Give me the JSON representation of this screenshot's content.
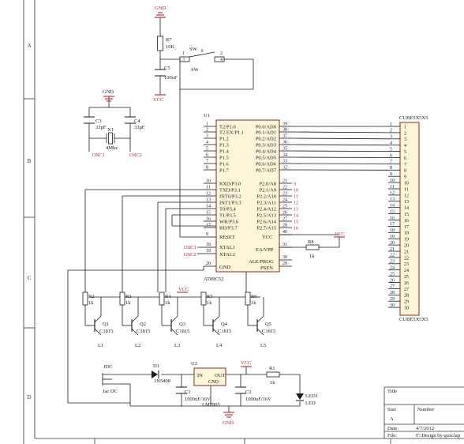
{
  "frame": {
    "rows": [
      "A",
      "B",
      "C",
      "D"
    ],
    "cols": [
      "1",
      "2",
      "3",
      "4"
    ]
  },
  "title_block": {
    "title_label": "Title",
    "size_label": "Size",
    "size_value": "A",
    "number_label": "Number",
    "date_label": "Date:",
    "date_value": "4/7/2012",
    "file_label": "File:",
    "file_value": "F:\\Design by quxclap"
  },
  "u1": {
    "ref": "U1",
    "part": "AT89C52",
    "left_pins": [
      {
        "num": "1",
        "name": "T2/P1.0"
      },
      {
        "num": "2",
        "name": "T2 EX/P1.1"
      },
      {
        "num": "3",
        "name": "P1.2"
      },
      {
        "num": "4",
        "name": "P1.3"
      },
      {
        "num": "5",
        "name": "P1.4"
      },
      {
        "num": "6",
        "name": "P1.5"
      },
      {
        "num": "7",
        "name": "P1.6"
      },
      {
        "num": "8",
        "name": "P1.7"
      },
      {
        "num": "10",
        "name": "RXD/P3.0"
      },
      {
        "num": "11",
        "name": "TXD/P3.1"
      },
      {
        "num": "12",
        "name": "INT0/P3.2"
      },
      {
        "num": "13",
        "name": "INT1/P3.3"
      },
      {
        "num": "14",
        "name": "T0/P3.4"
      },
      {
        "num": "15",
        "name": "T1/P3.5"
      },
      {
        "num": "16",
        "name": "WR/P3.6"
      },
      {
        "num": "17",
        "name": "RD/P3.7"
      }
    ],
    "right_pins": [
      {
        "num": "39",
        "name": "P0.0/AD0"
      },
      {
        "num": "38",
        "name": "P0.1/AD1"
      },
      {
        "num": "37",
        "name": "P0.2/AD2"
      },
      {
        "num": "36",
        "name": "P0.3/AD3"
      },
      {
        "num": "35",
        "name": "P0.4/AD4"
      },
      {
        "num": "34",
        "name": "P0.5/AD5"
      },
      {
        "num": "33",
        "name": "P0.6/AD6"
      },
      {
        "num": "32",
        "name": "P0.7/AD7"
      },
      {
        "num": "21",
        "name": "P2.0/A8",
        "net": "9"
      },
      {
        "num": "22",
        "name": "P2.1/A9",
        "net": "10"
      },
      {
        "num": "23",
        "name": "P2.2/A10",
        "net": "11"
      },
      {
        "num": "24",
        "name": "P2.3/A11",
        "net": "12"
      },
      {
        "num": "25",
        "name": "P2.4/A12",
        "net": "13"
      },
      {
        "num": "26",
        "name": "P2.5/A13",
        "net": "14"
      },
      {
        "num": "27",
        "name": "P2.6/A14",
        "net": "15"
      },
      {
        "num": "28",
        "name": "P2.7/A15",
        "net": "16"
      }
    ],
    "misc_pins": {
      "reset": {
        "num": "9",
        "name": "RESET"
      },
      "vcc": {
        "num": "40",
        "name": "VCC"
      },
      "xtal1": {
        "num": "18",
        "name": "XTAL1"
      },
      "xtal2": {
        "num": "19",
        "name": "XTAL2"
      },
      "gnd": {
        "num": "20",
        "name": "GND"
      },
      "ea": {
        "num": "31",
        "name": "EA/VPP"
      },
      "ale": {
        "num": "30",
        "name": "ALE/PROG"
      },
      "psen": {
        "num": "29",
        "name": "PSEN"
      }
    }
  },
  "cube": {
    "ref": "CUBE5X5X5",
    "part": "CUBE5X5X5",
    "pins": [
      "1",
      "2",
      "3",
      "4",
      "5",
      "6",
      "7",
      "8",
      "9",
      "10",
      "11",
      "12",
      "13",
      "14",
      "15",
      "16",
      "17",
      "18",
      "19",
      "20",
      "21",
      "22",
      "23",
      "24",
      "25",
      "26",
      "27",
      "28",
      "29",
      "30"
    ]
  },
  "reset_circuit": {
    "gnd": "GND",
    "r7_ref": "R7",
    "r7_val": "10K",
    "sw_ref": "SW",
    "sw_ref2": "SW",
    "sw_pin1": "1",
    "sw_pin2": "2",
    "sw_pin3": "3",
    "sw_pin4": "4",
    "c5_ref": "C5",
    "c5_val": "100uF",
    "vcc": "VCC"
  },
  "osc": {
    "gnd": "GND",
    "c3_ref": "C3",
    "c3_val": "33pF",
    "c4_ref": "C4",
    "c4_val": "33pF",
    "x1_ref": "X1",
    "x1_val": "4Mhz",
    "osc1": "OSC1",
    "osc2": "OSC2",
    "osc1_pin": "OSC1",
    "osc2_pin": "OSC2"
  },
  "r8": {
    "ref": "R8",
    "val": "1k",
    "vcc": "VCC"
  },
  "drivers": [
    {
      "r_ref": "R2",
      "r_val": "1k",
      "q_ref": "Q1",
      "q_val": "C1815",
      "line": "L1"
    },
    {
      "r_ref": "R3",
      "r_val": "1k",
      "q_ref": "Q2",
      "q_val": "C1815",
      "line": "L2"
    },
    {
      "r_ref": "R4",
      "r_val": "1k",
      "q_ref": "Q3",
      "q_val": "C1815",
      "line": "L3"
    },
    {
      "r_ref": "R5",
      "r_val": "1k",
      "q_ref": "Q4",
      "q_val": "C1815",
      "line": "L4"
    },
    {
      "r_ref": "R6",
      "r_val": "1k",
      "q_ref": "Q5",
      "q_val": "C1815",
      "line": "L5"
    }
  ],
  "drivers_vcc": "VCC",
  "power": {
    "jdc_ref": "JDC",
    "jdc_val": "Jac DC",
    "d1_ref": "D1",
    "d1_val": "1N5408",
    "u2_ref": "U2",
    "u2_part": "LM7805",
    "u2_in": "IN",
    "u2_gnd": "GND",
    "u2_out": "OUT",
    "c1_ref": "C1",
    "c1_val": "1000uF/16V",
    "c2_ref": "C2",
    "c2_val": "1000uF/16V",
    "vcc": "VCC",
    "r1_ref": "R1",
    "r1_val": "1k",
    "led_ref": "LED1",
    "led_val": "LED",
    "gnd": "GND"
  },
  "colors": {
    "wire": "#1a1a1a",
    "chip_fill": "#fdf6d8",
    "chip_border": "#8a2b22",
    "power_red": "#b8262c",
    "frame": "#333333"
  }
}
